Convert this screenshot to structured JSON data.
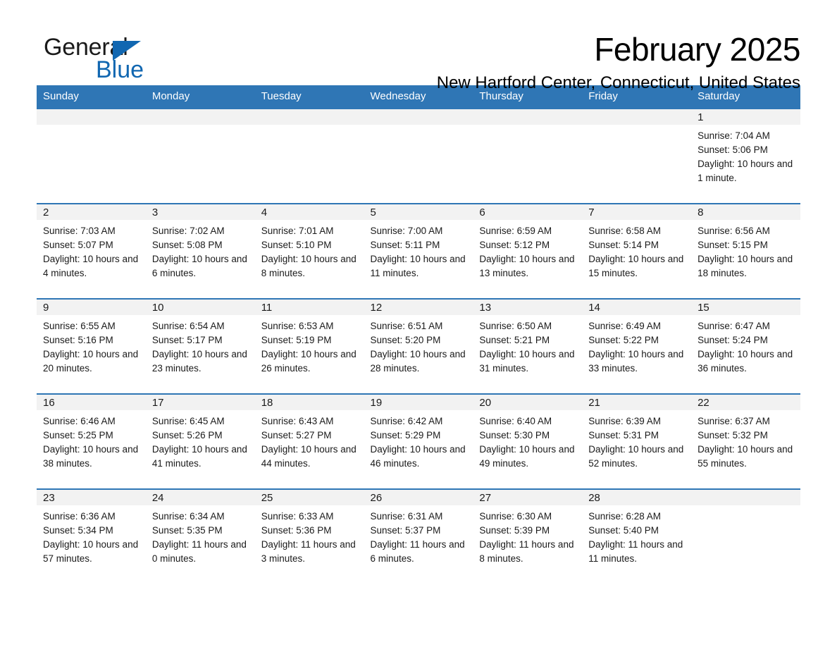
{
  "brand": {
    "name_part1": "General",
    "name_part2": "Blue",
    "triangle_color": "#1167b1",
    "accent_color": "#2f76b5"
  },
  "header": {
    "month_title": "February 2025",
    "location": "New Hartford Center, Connecticut, United States"
  },
  "calendar": {
    "weekday_headers": [
      "Sunday",
      "Monday",
      "Tuesday",
      "Wednesday",
      "Thursday",
      "Friday",
      "Saturday"
    ],
    "weeks": [
      [
        {
          "day": "",
          "sunrise": "",
          "sunset": "",
          "daylight": "",
          "empty": true
        },
        {
          "day": "",
          "sunrise": "",
          "sunset": "",
          "daylight": "",
          "empty": true
        },
        {
          "day": "",
          "sunrise": "",
          "sunset": "",
          "daylight": "",
          "empty": true
        },
        {
          "day": "",
          "sunrise": "",
          "sunset": "",
          "daylight": "",
          "empty": true
        },
        {
          "day": "",
          "sunrise": "",
          "sunset": "",
          "daylight": "",
          "empty": true
        },
        {
          "day": "",
          "sunrise": "",
          "sunset": "",
          "daylight": "",
          "empty": true
        },
        {
          "day": "1",
          "sunrise": "Sunrise: 7:04 AM",
          "sunset": "Sunset: 5:06 PM",
          "daylight": "Daylight: 10 hours and 1 minute.",
          "empty": false
        }
      ],
      [
        {
          "day": "2",
          "sunrise": "Sunrise: 7:03 AM",
          "sunset": "Sunset: 5:07 PM",
          "daylight": "Daylight: 10 hours and 4 minutes.",
          "empty": false
        },
        {
          "day": "3",
          "sunrise": "Sunrise: 7:02 AM",
          "sunset": "Sunset: 5:08 PM",
          "daylight": "Daylight: 10 hours and 6 minutes.",
          "empty": false
        },
        {
          "day": "4",
          "sunrise": "Sunrise: 7:01 AM",
          "sunset": "Sunset: 5:10 PM",
          "daylight": "Daylight: 10 hours and 8 minutes.",
          "empty": false
        },
        {
          "day": "5",
          "sunrise": "Sunrise: 7:00 AM",
          "sunset": "Sunset: 5:11 PM",
          "daylight": "Daylight: 10 hours and 11 minutes.",
          "empty": false
        },
        {
          "day": "6",
          "sunrise": "Sunrise: 6:59 AM",
          "sunset": "Sunset: 5:12 PM",
          "daylight": "Daylight: 10 hours and 13 minutes.",
          "empty": false
        },
        {
          "day": "7",
          "sunrise": "Sunrise: 6:58 AM",
          "sunset": "Sunset: 5:14 PM",
          "daylight": "Daylight: 10 hours and 15 minutes.",
          "empty": false
        },
        {
          "day": "8",
          "sunrise": "Sunrise: 6:56 AM",
          "sunset": "Sunset: 5:15 PM",
          "daylight": "Daylight: 10 hours and 18 minutes.",
          "empty": false
        }
      ],
      [
        {
          "day": "9",
          "sunrise": "Sunrise: 6:55 AM",
          "sunset": "Sunset: 5:16 PM",
          "daylight": "Daylight: 10 hours and 20 minutes.",
          "empty": false
        },
        {
          "day": "10",
          "sunrise": "Sunrise: 6:54 AM",
          "sunset": "Sunset: 5:17 PM",
          "daylight": "Daylight: 10 hours and 23 minutes.",
          "empty": false
        },
        {
          "day": "11",
          "sunrise": "Sunrise: 6:53 AM",
          "sunset": "Sunset: 5:19 PM",
          "daylight": "Daylight: 10 hours and 26 minutes.",
          "empty": false
        },
        {
          "day": "12",
          "sunrise": "Sunrise: 6:51 AM",
          "sunset": "Sunset: 5:20 PM",
          "daylight": "Daylight: 10 hours and 28 minutes.",
          "empty": false
        },
        {
          "day": "13",
          "sunrise": "Sunrise: 6:50 AM",
          "sunset": "Sunset: 5:21 PM",
          "daylight": "Daylight: 10 hours and 31 minutes.",
          "empty": false
        },
        {
          "day": "14",
          "sunrise": "Sunrise: 6:49 AM",
          "sunset": "Sunset: 5:22 PM",
          "daylight": "Daylight: 10 hours and 33 minutes.",
          "empty": false
        },
        {
          "day": "15",
          "sunrise": "Sunrise: 6:47 AM",
          "sunset": "Sunset: 5:24 PM",
          "daylight": "Daylight: 10 hours and 36 minutes.",
          "empty": false
        }
      ],
      [
        {
          "day": "16",
          "sunrise": "Sunrise: 6:46 AM",
          "sunset": "Sunset: 5:25 PM",
          "daylight": "Daylight: 10 hours and 38 minutes.",
          "empty": false
        },
        {
          "day": "17",
          "sunrise": "Sunrise: 6:45 AM",
          "sunset": "Sunset: 5:26 PM",
          "daylight": "Daylight: 10 hours and 41 minutes.",
          "empty": false
        },
        {
          "day": "18",
          "sunrise": "Sunrise: 6:43 AM",
          "sunset": "Sunset: 5:27 PM",
          "daylight": "Daylight: 10 hours and 44 minutes.",
          "empty": false
        },
        {
          "day": "19",
          "sunrise": "Sunrise: 6:42 AM",
          "sunset": "Sunset: 5:29 PM",
          "daylight": "Daylight: 10 hours and 46 minutes.",
          "empty": false
        },
        {
          "day": "20",
          "sunrise": "Sunrise: 6:40 AM",
          "sunset": "Sunset: 5:30 PM",
          "daylight": "Daylight: 10 hours and 49 minutes.",
          "empty": false
        },
        {
          "day": "21",
          "sunrise": "Sunrise: 6:39 AM",
          "sunset": "Sunset: 5:31 PM",
          "daylight": "Daylight: 10 hours and 52 minutes.",
          "empty": false
        },
        {
          "day": "22",
          "sunrise": "Sunrise: 6:37 AM",
          "sunset": "Sunset: 5:32 PM",
          "daylight": "Daylight: 10 hours and 55 minutes.",
          "empty": false
        }
      ],
      [
        {
          "day": "23",
          "sunrise": "Sunrise: 6:36 AM",
          "sunset": "Sunset: 5:34 PM",
          "daylight": "Daylight: 10 hours and 57 minutes.",
          "empty": false
        },
        {
          "day": "24",
          "sunrise": "Sunrise: 6:34 AM",
          "sunset": "Sunset: 5:35 PM",
          "daylight": "Daylight: 11 hours and 0 minutes.",
          "empty": false
        },
        {
          "day": "25",
          "sunrise": "Sunrise: 6:33 AM",
          "sunset": "Sunset: 5:36 PM",
          "daylight": "Daylight: 11 hours and 3 minutes.",
          "empty": false
        },
        {
          "day": "26",
          "sunrise": "Sunrise: 6:31 AM",
          "sunset": "Sunset: 5:37 PM",
          "daylight": "Daylight: 11 hours and 6 minutes.",
          "empty": false
        },
        {
          "day": "27",
          "sunrise": "Sunrise: 6:30 AM",
          "sunset": "Sunset: 5:39 PM",
          "daylight": "Daylight: 11 hours and 8 minutes.",
          "empty": false
        },
        {
          "day": "28",
          "sunrise": "Sunrise: 6:28 AM",
          "sunset": "Sunset: 5:40 PM",
          "daylight": "Daylight: 11 hours and 11 minutes.",
          "empty": false
        },
        {
          "day": "",
          "sunrise": "",
          "sunset": "",
          "daylight": "",
          "empty": true
        }
      ]
    ]
  }
}
